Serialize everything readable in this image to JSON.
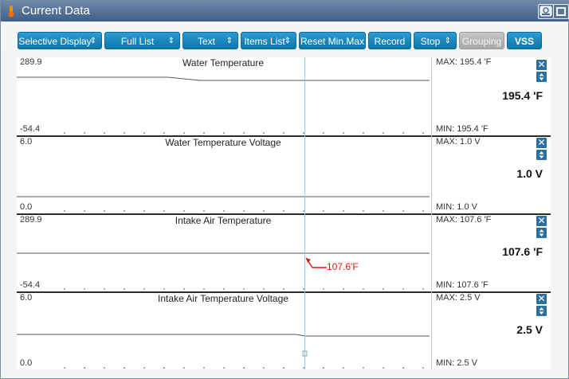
{
  "window": {
    "title": "Current Data"
  },
  "toolbar": {
    "selective_display": "Selective Display",
    "full_list": "Full List",
    "text": "Text",
    "items_list": "Items List",
    "reset_min_max": "Reset Min.Max",
    "record": "Record",
    "stop": "Stop",
    "grouping": "Grouping",
    "vss": "VSS",
    "dropdown_arrow": "⇕"
  },
  "graphs": [
    {
      "title": "Water Temperature",
      "max": "289.9",
      "min": "-54.4",
      "side_max": "MAX: 195.4 'F",
      "side_min": "MIN: 195.4 'F",
      "value": "195.4 'F"
    },
    {
      "title": "Water Temperature Voltage",
      "max": "6.0",
      "min": "0.0",
      "side_max": "MAX:   1.0 V",
      "side_min": "MIN:   1.0 V",
      "value": "1.0 V"
    },
    {
      "title": "Intake Air Temperature",
      "max": "289.9",
      "min": "-54.4",
      "side_max": "MAX: 107.6 'F",
      "side_min": "MIN: 107.6 'F",
      "value": "107.6 'F"
    },
    {
      "title": "Intake Air Temperature Voltage",
      "max": "6.0",
      "min": "0.0",
      "side_max": "MAX:   2.5 V",
      "side_min": "MIN:   2.5 V",
      "value": "2.5 V"
    }
  ],
  "cursor_annotation": "107.6'F",
  "colors": {
    "accent": "#1a8cc4",
    "title_bar": "#4d6b91",
    "annotation": "#e0170e",
    "cursor": "#8fd2d8"
  },
  "icons": {
    "close": "✕",
    "scroll": "⇕"
  }
}
